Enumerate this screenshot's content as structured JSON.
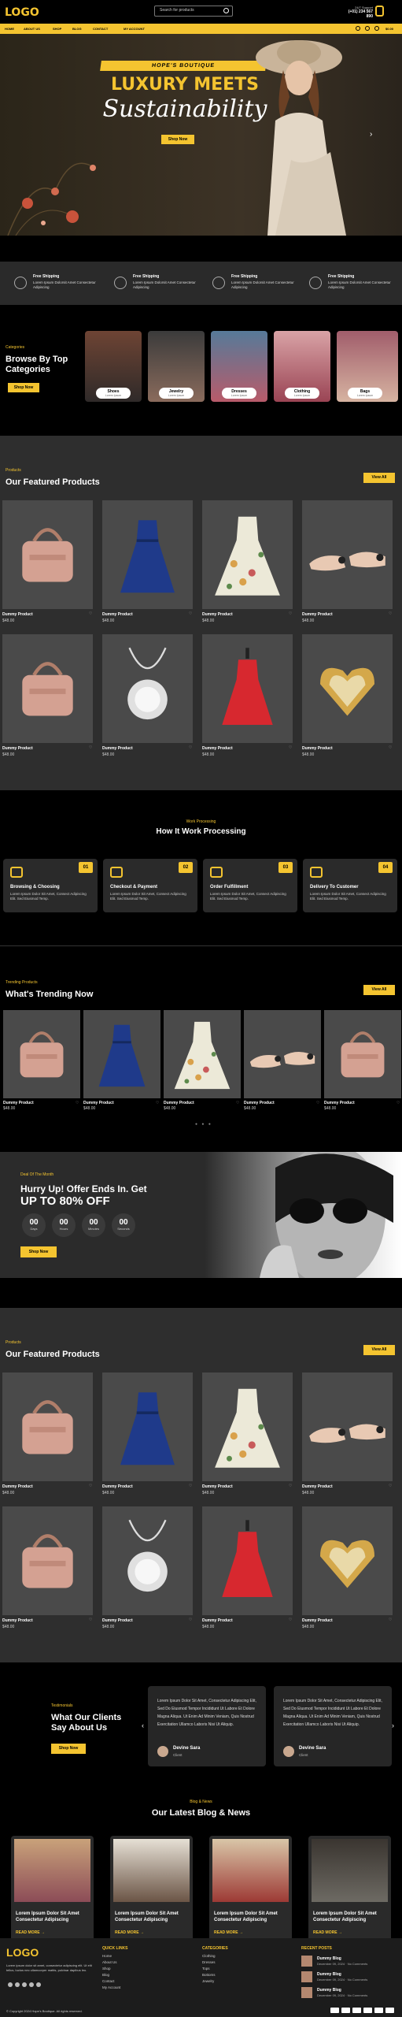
{
  "header": {
    "logo": "LOGO",
    "search_placeholder": "Search for products",
    "support_label": "24/7 Support",
    "support_phone": "(+01) 234 567 890",
    "cart_total": "$0.00"
  },
  "nav": {
    "items": [
      "HOME",
      "ABOUT US",
      "SHOP",
      "BLOG",
      "CONTACT",
      "MY ACCOUNT"
    ]
  },
  "hero": {
    "tagline": "HOPE'S BOUTIQUE",
    "title": "LUXURY MEETS",
    "script": "Sustainability",
    "button": "Shop Now"
  },
  "features": [
    {
      "title": "Free Shipping",
      "desc": "Lorem Ipsum Dolorsit Amet Consectetur Adipiscing"
    },
    {
      "title": "Free Shipping",
      "desc": "Lorem Ipsum Dolorsit Amet Consectetur Adipiscing"
    },
    {
      "title": "Free Shipping",
      "desc": "Lorem Ipsum Dolorsit Amet Consectetur Adipiscing"
    },
    {
      "title": "Free Shipping",
      "desc": "Lorem Ipsum Dolorsit Amet Consectetur Adipiscing"
    }
  ],
  "categories": {
    "label": "Categories",
    "heading": "Browse By Top Categories",
    "button": "Shop Now",
    "items": [
      {
        "name": "Shoes",
        "count": "Lorem Ipsum"
      },
      {
        "name": "Jewelry",
        "count": "Lorem Ipsum"
      },
      {
        "name": "Dresses",
        "count": "Lorem Ipsum"
      },
      {
        "name": "Clothing",
        "count": "Lorem Ipsum"
      },
      {
        "name": "Bags",
        "count": "Lorem Ipsum"
      }
    ]
  },
  "featured": {
    "label": "Products",
    "heading": "Our Featured Products",
    "view_all": "View All",
    "products": [
      {
        "name": "Dummy Product",
        "price": "$48.00",
        "kind": "bag"
      },
      {
        "name": "Dummy Product",
        "price": "$48.00",
        "kind": "dress-blue"
      },
      {
        "name": "Dummy Product",
        "price": "$48.00",
        "kind": "dress-floral"
      },
      {
        "name": "Dummy Product",
        "price": "$48.00",
        "kind": "shoes"
      },
      {
        "name": "Dummy Product",
        "price": "$48.00",
        "kind": "bag"
      },
      {
        "name": "Dummy Product",
        "price": "$48.00",
        "kind": "necklace"
      },
      {
        "name": "Dummy Product",
        "price": "$48.00",
        "kind": "dress-red"
      },
      {
        "name": "Dummy Product",
        "price": "$48.00",
        "kind": "ring"
      }
    ]
  },
  "process": {
    "label": "Work Processing",
    "heading": "How It Work Processing",
    "steps": [
      {
        "num": "01",
        "title": "Browsing & Choosing",
        "desc": "Lorem Ipsum Dolor Sit Amet, Consect Adipiscing Elit. Sed Eiusmod Temp."
      },
      {
        "num": "02",
        "title": "Checkout & Payment",
        "desc": "Lorem Ipsum Dolor Sit Amet, Consect Adipiscing Elit. Sed Eiusmod Temp."
      },
      {
        "num": "03",
        "title": "Order Fulfillment",
        "desc": "Lorem Ipsum Dolor Sit Amet, Consect Adipiscing Elit. Sed Eiusmod Temp."
      },
      {
        "num": "04",
        "title": "Delivery To Customer",
        "desc": "Lorem Ipsum Dolor Sit Amet, Consect Adipiscing Elit. Sed Eiusmod Temp."
      }
    ]
  },
  "trending": {
    "label": "Trending Products",
    "heading": "What's Trending Now",
    "view_all": "View All",
    "products": [
      {
        "name": "Dummy Product",
        "price": "$48.00",
        "kind": "bag"
      },
      {
        "name": "Dummy Product",
        "price": "$48.00",
        "kind": "dress-blue"
      },
      {
        "name": "Dummy Product",
        "price": "$48.00",
        "kind": "dress-floral"
      },
      {
        "name": "Dummy Product",
        "price": "$48.00",
        "kind": "shoes"
      },
      {
        "name": "Dummy Product",
        "price": "$48.00",
        "kind": "bag"
      }
    ]
  },
  "offer": {
    "label": "Deal Of The Month",
    "title1": "Hurry Up! Offer Ends In. Get",
    "title2": "UP TO 80% OFF",
    "timer": [
      {
        "value": "00",
        "unit": "Days"
      },
      {
        "value": "00",
        "unit": "Hours"
      },
      {
        "value": "00",
        "unit": "Minutes"
      },
      {
        "value": "00",
        "unit": "Seconds"
      }
    ],
    "button": "Shop Now"
  },
  "featured2": {
    "label": "Products",
    "heading": "Our Featured Products",
    "view_all": "View All"
  },
  "testimonials": {
    "label": "Testimonials",
    "heading": "What Our Clients Say About Us",
    "button": "Shop Now",
    "items": [
      {
        "quote": "Lorem Ipsum Dolor Sit Amet, Consectetur Adipiscing Elit, Sed Do Eiusmod Tempor Incididunt Ut Labore Et Dolore Magna Aliqua. Ut Enim Ad Minim Veniam, Quis Nostrud Exercitation Ullamco Laboris Nisi Ut Aliquip.",
        "name": "Devine Sara",
        "role": "Client"
      },
      {
        "quote": "Lorem Ipsum Dolor Sit Amet, Consectetur Adipiscing Elit, Sed Do Eiusmod Tempor Incididunt Ut Labore Et Dolore Magna Aliqua. Ut Enim Ad Minim Veniam, Quis Nostrud Exercitation Ullamco Laboris Nisi Ut Aliquip.",
        "name": "Devine Sara",
        "role": "Client"
      }
    ]
  },
  "blog": {
    "label": "Blog & News",
    "heading": "Our Latest Blog & News",
    "posts": [
      {
        "title": "Lorem Ipsum Dolor Sit Amet Consectetur Adipiscing",
        "more": "READ MORE →"
      },
      {
        "title": "Lorem Ipsum Dolor Sit Amet Consectetur Adipiscing",
        "more": "READ MORE →"
      },
      {
        "title": "Lorem Ipsum Dolor Sit Amet Consectetur Adipiscing",
        "more": "READ MORE →"
      },
      {
        "title": "Lorem Ipsum Dolor Sit Amet Consectetur Adipiscing",
        "more": "READ MORE →"
      }
    ]
  },
  "footer": {
    "logo": "LOGO",
    "desc": "Lorem ipsum dolor sit amet, consectetur adipiscing elit. Ut elit tellus, luctus nec ullamcorper mattis, pulvinar dapibus leo.",
    "quick_title": "QUICK LINKS",
    "quick": [
      "Home",
      "About Us",
      "Shop",
      "Blog",
      "Contact",
      "My Account"
    ],
    "cat_title": "CATEGORIES",
    "cats": [
      "Clothing",
      "Dresses",
      "Tops",
      "Bottoms",
      "Jewelry"
    ],
    "recent_title": "RECENT POSTS",
    "recent": [
      {
        "title": "Dummy Blog",
        "date": "December 09, 2024 · No Comments"
      },
      {
        "title": "Dummy Blog",
        "date": "December 09, 2024 · No Comments"
      },
      {
        "title": "Dummy Blog",
        "date": "December 09, 2024 · No Comments"
      }
    ],
    "copyright": "© Copyright 2024 Hope's Boutique. All rights reserved."
  },
  "colors": {
    "accent": "#f4c430",
    "bg": "#000000",
    "panel": "#2e2e2e"
  }
}
